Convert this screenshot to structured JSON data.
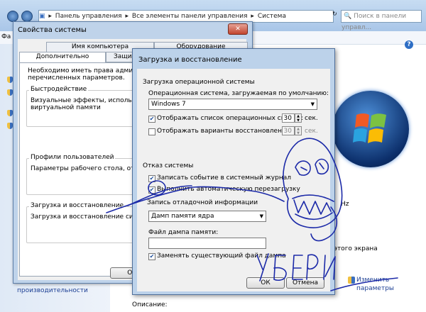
{
  "explorer": {
    "breadcrumb": [
      "Панель управления",
      "Все элементы панели управления",
      "Система"
    ],
    "search_placeholder": "Поиск в панели управл...",
    "menu_first": "Фа",
    "left_bottom_text": "производительности",
    "footer_label": "Описание:",
    "right_fragment_hz": "Hz",
    "right_fragment_screen": "этого экрана",
    "change_params": [
      "Изменить",
      "параметры"
    ]
  },
  "system_properties": {
    "title": "Свойства системы",
    "tabs": [
      "Имя компьютера",
      "Оборудование",
      "Дополнительно",
      "Защита си"
    ],
    "intro": [
      "Необходимо иметь права администр",
      "перечисленных параметров."
    ],
    "groups": [
      {
        "label": "Быстродействие",
        "lines": [
          "Визуальные эффекты, использован",
          "виртуальной памяти"
        ]
      },
      {
        "label": "Профили пользователей",
        "lines": [
          "Параметры рабочего стола, относя"
        ]
      },
      {
        "label": "Загрузка и восстановление",
        "lines": [
          "Загрузка и восстановление систем"
        ]
      }
    ],
    "ok_label": "ОК"
  },
  "boot_recovery": {
    "title": "Загрузка и восстановление",
    "startup": {
      "group_label": "Загрузка операционной системы",
      "default_os_label": "Операционная система, загружаемая по умолчанию:",
      "default_os_value": "Windows 7",
      "show_list_label": "Отображать список операционных систем:",
      "show_list_checked": true,
      "show_list_value": "30",
      "show_recovery_label": "Отображать варианты восстановления:",
      "show_recovery_checked": false,
      "show_recovery_value": "30",
      "sec_label": "сек."
    },
    "failure": {
      "group_label": "Отказ системы",
      "write_event_label": "Записать событие в системный журнал",
      "write_event_checked": true,
      "auto_restart_label": "Выполнить автоматическую перезагрузку",
      "auto_restart_checked": true,
      "debug_info_label": "Запись отладочной информации",
      "debug_info_value": "Дамп памяти ядра",
      "dump_file_label": "Файл дампа памяти:",
      "dump_file_value": "",
      "overwrite_label": "Заменять существующий файл дампа",
      "overwrite_checked": true
    },
    "ok_label": "ОК",
    "cancel_label": "Отмена"
  },
  "doodle": {
    "text": "УБЕРИ",
    "color": "#1c2aa8"
  }
}
